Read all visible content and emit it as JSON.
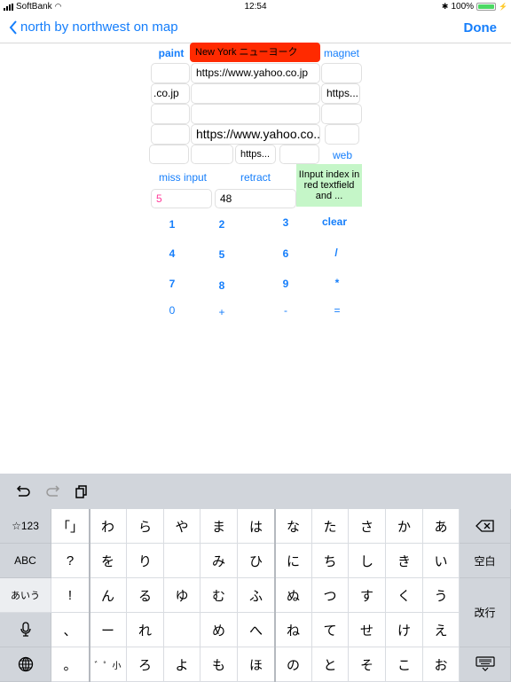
{
  "status_bar": {
    "carrier": "SoftBank",
    "time": "12:54",
    "battery": "100%",
    "icons": [
      "signal-icon",
      "wifi-icon",
      "bluetooth-icon",
      "battery-icon",
      "charging-icon"
    ],
    "battery_color": "#4cd964"
  },
  "nav": {
    "back_label": "north by northwest on map",
    "done_label": "Done",
    "accent": "#157efb"
  },
  "form": {
    "paint_label": "paint",
    "red_field": "New York ニューヨーク",
    "magnet_label": "magnet",
    "row1": {
      "left": "",
      "center": "https://www.yahoo.co.jp",
      "right": ""
    },
    "row2": {
      "left": ".co.jp",
      "center": "",
      "right": "https..."
    },
    "row3": {
      "left": "",
      "center": "",
      "right": ""
    },
    "row4": {
      "left": "",
      "center": "https://www.yahoo.co...",
      "right": ""
    },
    "row5": {
      "a": "",
      "b": "",
      "c": "https...",
      "d": "",
      "web_label": "web"
    },
    "miss_input_label": "miss input",
    "retract_label": "retract",
    "green_text": "IInput index in red textfield and ...",
    "index_field": "5",
    "value_field": "48",
    "red_color": "#ff2a00",
    "green_color": "#c5f6c8",
    "pink_text_color": "#ff3b9a"
  },
  "calculator": {
    "rows": [
      [
        "1",
        "2",
        "3",
        "clear"
      ],
      [
        "4",
        "5",
        "6",
        "/"
      ],
      [
        "7",
        "8",
        "9",
        "*"
      ],
      [
        "0",
        "+",
        "-",
        "="
      ]
    ]
  },
  "keyboard": {
    "toolbar": {
      "undo": "undo-icon",
      "redo": "redo-icon",
      "paste": "paste-icon"
    },
    "left_column": [
      "☆123",
      "ABC",
      "あいう",
      "mic",
      "globe"
    ],
    "punct_column": [
      "「」",
      "?",
      "!",
      "、",
      "。"
    ],
    "kana_rows": [
      [
        "わ",
        "ら",
        "や",
        "ま",
        "は",
        "な",
        "た",
        "さ",
        "か",
        "あ"
      ],
      [
        "を",
        "り",
        "",
        "み",
        "ひ",
        "に",
        "ち",
        "し",
        "き",
        "い"
      ],
      [
        "ん",
        "る",
        "ゆ",
        "む",
        "ふ",
        "ぬ",
        "つ",
        "す",
        "く",
        "う"
      ],
      [
        "ー",
        "れ",
        "",
        "め",
        "へ",
        "ね",
        "て",
        "せ",
        "け",
        "え"
      ],
      [
        "゛゜小",
        "ろ",
        "よ",
        "も",
        "ほ",
        "の",
        "と",
        "そ",
        "こ",
        "お"
      ]
    ],
    "right_column": {
      "delete": "delete-icon",
      "space": "空白",
      "return": "改行",
      "dismiss": "keyboard-dismiss-icon"
    }
  }
}
